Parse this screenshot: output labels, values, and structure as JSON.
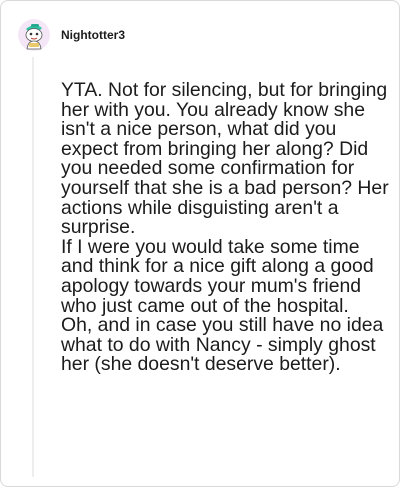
{
  "comment": {
    "author": "Nightotter3",
    "paragraphs": [
      "YTA. Not for silencing, but for bringing her with you. You already know she isn't a nice person, what did you expect from bringing her along? Did you needed some confirmation for yourself that she is a bad person? Her actions while disguisting aren't a surprise.",
      "If I were you would take some time and think for a nice gift along a good apology towards your mum's friend who just came out of the hospital.",
      "Oh, and in case you still have no idea what to do with Nancy - simply ghost her (she doesn't deserve better)."
    ]
  },
  "colors": {
    "text": "#1c1c1c",
    "border": "#d9d9d9",
    "thread_line": "#eeeeee",
    "avatar_bg": "#f4e6f6",
    "avatar_accent": "#2ec4a6"
  },
  "icons": {
    "avatar": "snoo-avatar-icon"
  }
}
